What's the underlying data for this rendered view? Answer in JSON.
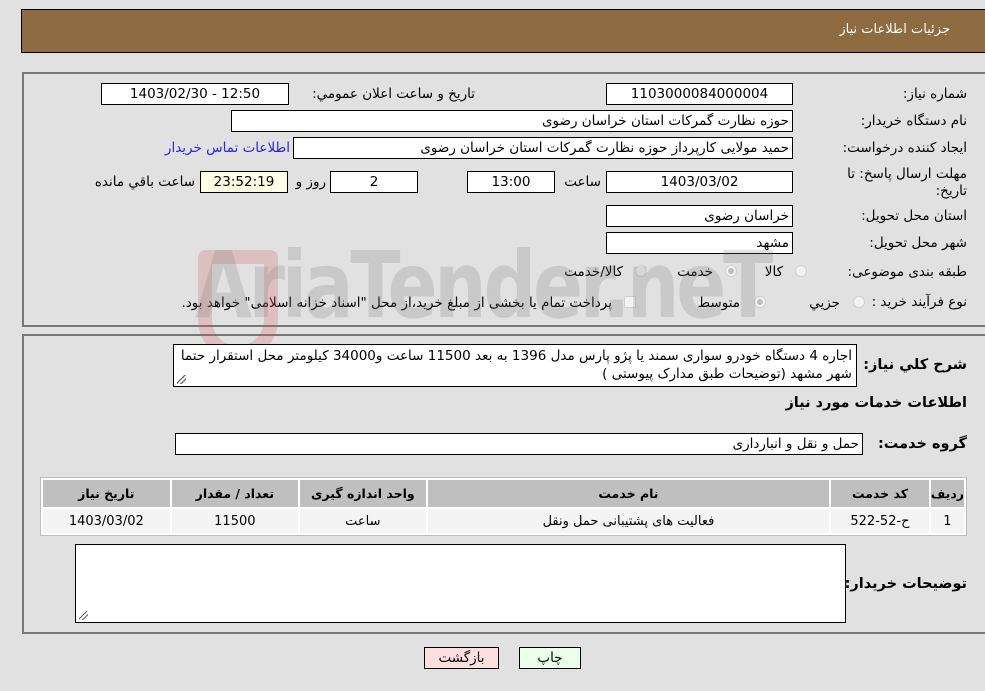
{
  "header": {
    "title": "جزئیات اطلاعات نیاز"
  },
  "form": {
    "need_number_label": "شماره نیاز:",
    "need_number": "1103000084000004",
    "announce_label": "تاریخ و ساعت اعلان عمومي:",
    "announce_value": "1403/02/30 - 12:50",
    "buyer_org_label": "نام دستگاه خریدار:",
    "buyer_org": "حوزه نظارت گمرکات استان خراسان رضوی",
    "creator_label": "ایجاد کننده درخواست:",
    "creator": "حمید مولایی کارپرداز حوزه نظارت گمرکات استان خراسان رضوی",
    "contact_link": "اطلاعات تماس خریدار",
    "deadline_label": "مهلت ارسال پاسخ: تا تاریخ:",
    "deadline_date": "1403/03/02",
    "time_label": "ساعت",
    "deadline_time": "13:00",
    "days": "2",
    "days_label": "روز و",
    "remaining": "23:52:19",
    "remaining_label": "ساعت باقي مانده",
    "province_label": "استان محل تحویل:",
    "province": "خراسان رضوی",
    "city_label": "شهر محل تحویل:",
    "city": "مشهد",
    "category_label": "طبقه بندی موضوعی:",
    "category_options": [
      "کالا",
      "خدمت",
      "کالا/خدمت"
    ],
    "category_selected": "خدمت",
    "process_label": "نوع فرآیند خرید :",
    "process_options": [
      "جزیي",
      "متوسط"
    ],
    "process_selected": "متوسط",
    "treasury_note": "پرداخت تمام یا بخشی از مبلغ خرید،از محل \"اسناد خزانه اسلامی\" خواهد بود."
  },
  "description": {
    "label": "شرح کلي نیاز:",
    "text": "اجاره 4 دستگاه خودرو سواری سمند یا پژو پارس مدل 1396 به بعد 11500 ساعت و34000 کیلومتر محل استقرار حتما شهر مشهد (توضیحات طبق مدارک پیوستی )"
  },
  "services": {
    "section_title": "اطلاعات خدمات مورد نیاز",
    "group_label": "گروه خدمت:",
    "group_value": "حمل و نقل و انبارداری",
    "columns": [
      "ردیف",
      "کد خدمت",
      "نام خدمت",
      "واحد اندازه گیری",
      "تعداد / مقدار",
      "تاریخ نیاز"
    ],
    "rows": [
      [
        "1",
        "ح-52-522",
        "فعالیت های پشتیبانی حمل ونقل",
        "ساعت",
        "11500",
        "1403/03/02"
      ]
    ]
  },
  "buyer_notes": {
    "label": "توضیحات خریدار:",
    "value": ""
  },
  "buttons": {
    "print": "چاپ",
    "back": "بازگشت"
  },
  "watermark": "AriaTender.neT"
}
